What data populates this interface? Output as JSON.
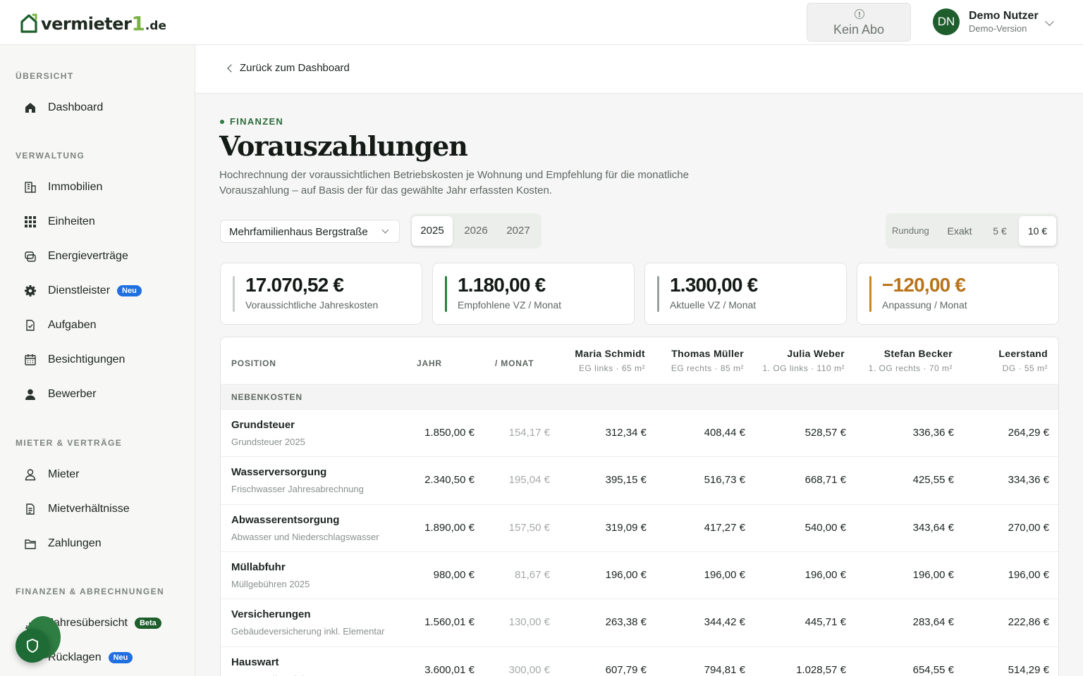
{
  "brand": {
    "name": "vermieter",
    "number": "1",
    "tld": ".de"
  },
  "header": {
    "subscription_label": "Kein Abo",
    "user": {
      "initials": "DN",
      "name": "Demo Nutzer",
      "subtitle": "Demo-Version"
    }
  },
  "sidebar": {
    "sections": [
      {
        "title": "ÜBERSICHT"
      },
      {
        "title": "VERWALTUNG"
      },
      {
        "title": "MIETER & VERTRÄGE"
      },
      {
        "title": "FINANZEN & ABRECHNUNGEN"
      }
    ],
    "items": [
      {
        "label": "Dashboard",
        "icon": "home-icon"
      },
      {
        "label": "Immobilien",
        "icon": "building-icon"
      },
      {
        "label": "Einheiten",
        "icon": "grid-icon"
      },
      {
        "label": "Energieverträge",
        "icon": "energy-contract-icon"
      },
      {
        "label": "Dienstleister",
        "icon": "gear-icon",
        "badge": "Neu"
      },
      {
        "label": "Aufgaben",
        "icon": "task-icon"
      },
      {
        "label": "Besichtigungen",
        "icon": "calendar-icon"
      },
      {
        "label": "Bewerber",
        "icon": "person-filled-icon"
      },
      {
        "label": "Mieter",
        "icon": "person-outline-icon"
      },
      {
        "label": "Mietverhältnisse",
        "icon": "document-icon"
      },
      {
        "label": "Zahlungen",
        "icon": "folder-icon"
      },
      {
        "label": "Jahresübersicht",
        "icon": "chart-icon",
        "badge": "Beta"
      },
      {
        "label": "Rücklagen",
        "icon": "savings-icon",
        "badge": "Neu"
      }
    ]
  },
  "back": {
    "label": "Zurück zum Dashboard"
  },
  "page": {
    "kicker": "FINANZEN",
    "title": "Vorauszahlungen",
    "subtitle": "Hochrechnung der voraussichtlichen Betriebskosten je Wohnung und Empfehlung für die monatliche Vorauszahlung – auf Basis der für das gewählte Jahr erfassten Kosten."
  },
  "controls": {
    "property": "Mehrfamilienhaus Bergstraße",
    "years": [
      "2025",
      "2026",
      "2027"
    ],
    "active_year": "2025",
    "rounding_label": "Rundung",
    "rounding_options": [
      "Exakt",
      "5 €",
      "10 €"
    ],
    "active_rounding": "10 €"
  },
  "stats": [
    {
      "value": "17.070,52 €",
      "caption": "Voraussichtliche Jahreskosten",
      "accent": "#c9cdca",
      "value_color": "#141a16"
    },
    {
      "value": "1.180,00 €",
      "caption": "Empfohlene VZ / Monat",
      "accent": "#2e7d42",
      "value_color": "#141a16"
    },
    {
      "value": "1.300,00 €",
      "caption": "Aktuelle VZ / Monat",
      "accent": "#9aa19c",
      "value_color": "#141a16"
    },
    {
      "value": "−120,00 €",
      "caption": "Anpassung / Monat",
      "accent": "#c9871f",
      "value_color": "#b9741a"
    }
  ],
  "table": {
    "headers": {
      "position": "POSITION",
      "year": "JAHR",
      "month": "/ MONAT"
    },
    "tenants": [
      {
        "name": "Maria Schmidt",
        "detail": "EG links · 65 m²"
      },
      {
        "name": "Thomas Müller",
        "detail": "EG rechts · 85 m²"
      },
      {
        "name": "Julia Weber",
        "detail": "1. OG links · 110 m²"
      },
      {
        "name": "Stefan Becker",
        "detail": "1. OG rechts · 70 m²"
      },
      {
        "name": "Leerstand",
        "detail": "DG · 55 m²"
      }
    ],
    "group": "NEBENKOSTEN",
    "rows": [
      {
        "name": "Grundsteuer",
        "sub": "Grundsteuer 2025",
        "year": "1.850,00 €",
        "month": "154,17 €",
        "values": [
          "312,34 €",
          "408,44 €",
          "528,57 €",
          "336,36 €",
          "264,29 €"
        ]
      },
      {
        "name": "Wasserversorgung",
        "sub": "Frischwasser Jahresabrechnung",
        "year": "2.340,50 €",
        "month": "195,04 €",
        "values": [
          "395,15 €",
          "516,73 €",
          "668,71 €",
          "425,55 €",
          "334,36 €"
        ]
      },
      {
        "name": "Abwasserentsorgung",
        "sub": "Abwasser und Niederschlagswasser",
        "year": "1.890,00 €",
        "month": "157,50 €",
        "values": [
          "319,09 €",
          "417,27 €",
          "540,00 €",
          "343,64 €",
          "270,00 €"
        ]
      },
      {
        "name": "Müllabfuhr",
        "sub": "Müllgebühren 2025",
        "year": "980,00 €",
        "month": "81,67 €",
        "values": [
          "196,00 €",
          "196,00 €",
          "196,00 €",
          "196,00 €",
          "196,00 €"
        ]
      },
      {
        "name": "Versicherungen",
        "sub": "Gebäudeversicherung inkl. Elementar",
        "year": "1.560,01 €",
        "month": "130,00 €",
        "values": [
          "263,38 €",
          "344,42 €",
          "445,71 €",
          "283,64 €",
          "222,86 €"
        ]
      },
      {
        "name": "Hauswart",
        "sub": "Hauswartdienstleistungen",
        "year": "3.600,01 €",
        "month": "300,00 €",
        "values": [
          "607,79 €",
          "794,81 €",
          "1.028,57 €",
          "654,55 €",
          "514,29 €"
        ]
      }
    ]
  }
}
